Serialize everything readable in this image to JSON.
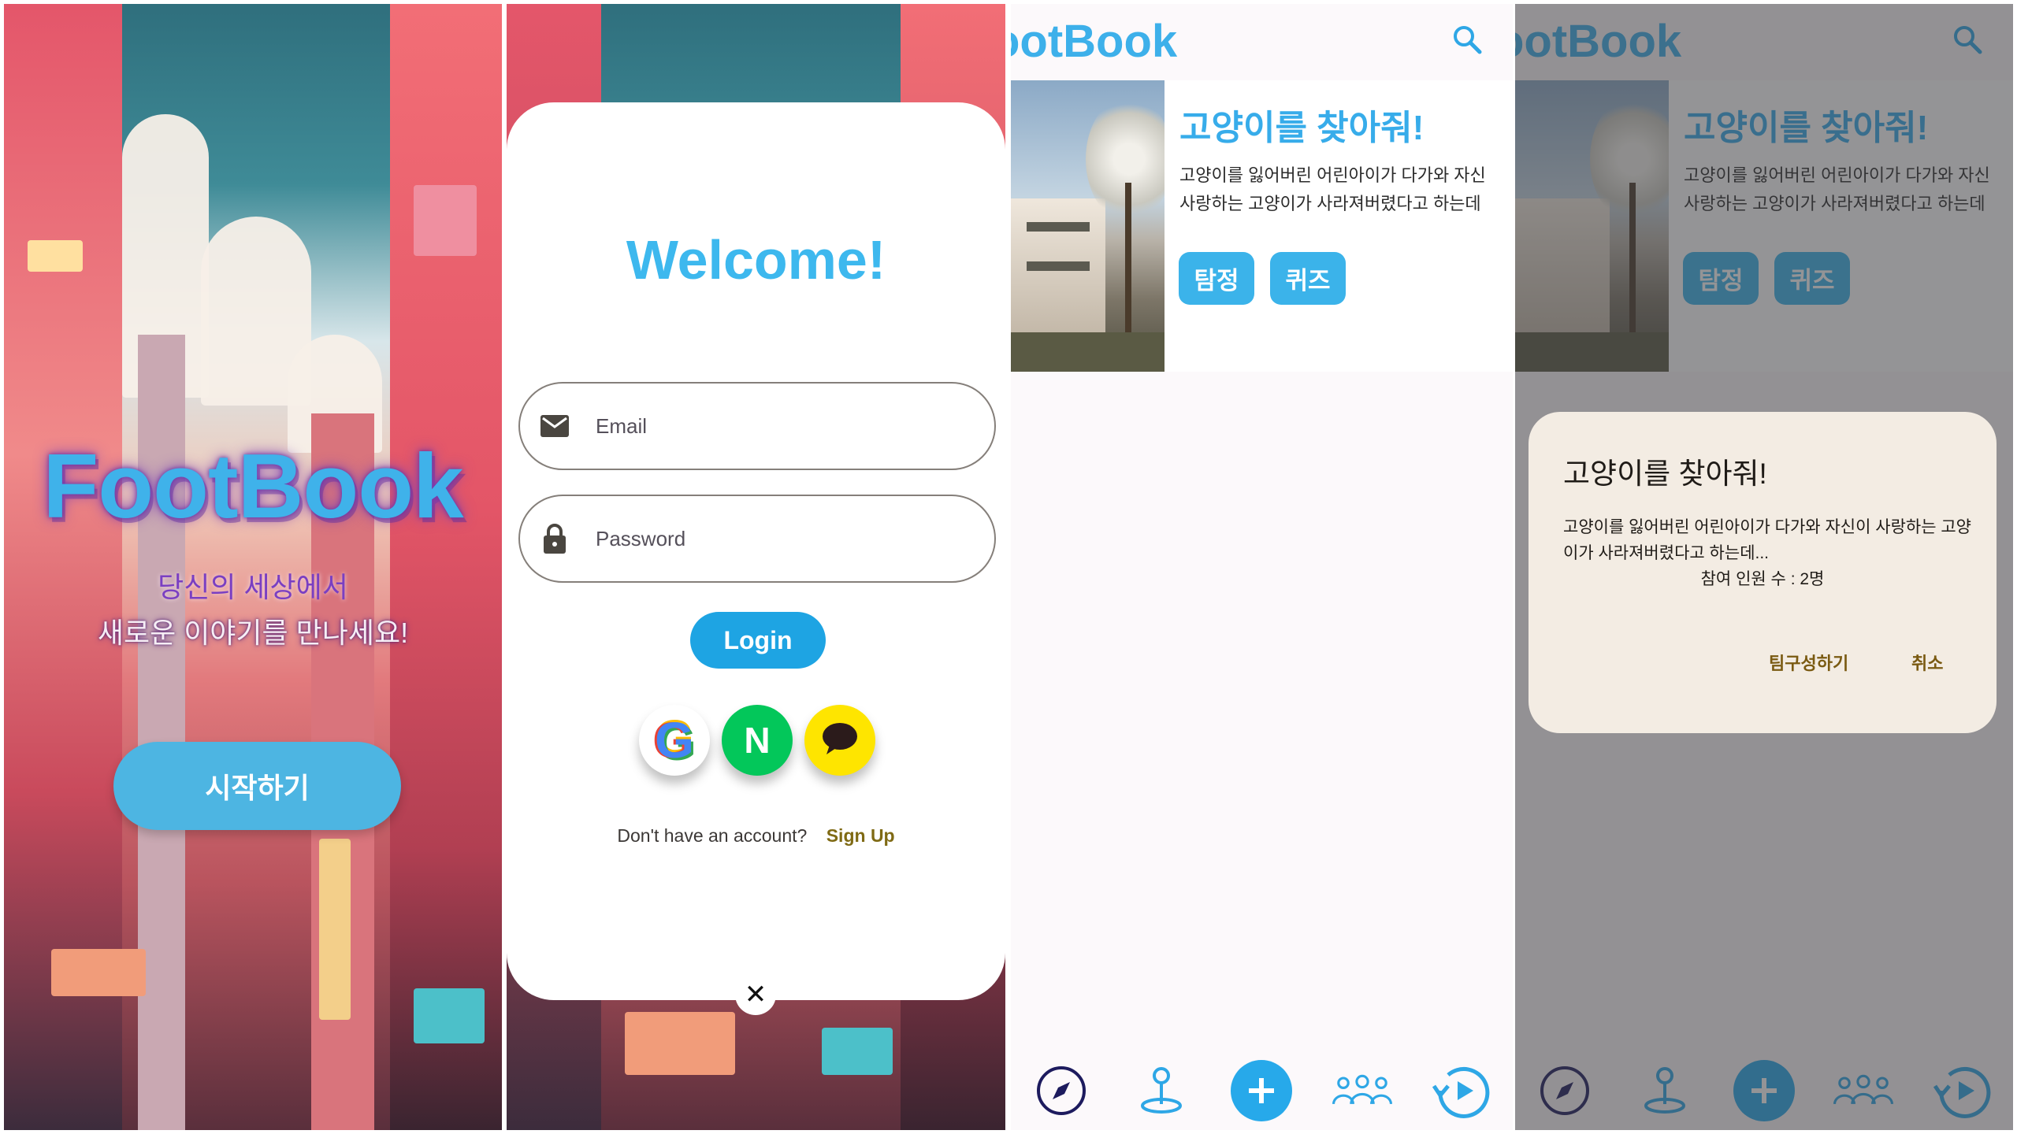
{
  "splash": {
    "brand": "FootBook",
    "tagline_line1": "당신의 세상에서",
    "tagline_line2": "새로운 이야기를 만나세요!",
    "start_button": "시작하기"
  },
  "login": {
    "welcome": "Welcome!",
    "email_placeholder": "Email",
    "password_placeholder": "Password",
    "login_button": "Login",
    "social": {
      "google": "G",
      "naver": "N"
    },
    "no_account_text": "Don't have an account?",
    "signup_link": "Sign Up",
    "close_glyph": "✕"
  },
  "feed": {
    "app_title": "ootBook",
    "post": {
      "title": "고양이를 찾아줘!",
      "desc_line1": "고양이를 잃어버린 어린아이가 다가와 자신",
      "desc_line2": "사랑하는 고양이가 사라져버렸다고 하는데",
      "chip_detective": "탐정",
      "chip_quiz": "퀴즈"
    },
    "nav": [
      "compass-icon",
      "map-pin-icon",
      "add-icon",
      "group-icon",
      "history-icon"
    ]
  },
  "dialog": {
    "title": "고양이를 찾아줘!",
    "body": "고양이를 잃어버린 어린아이가 다가와 자신이 사랑하는 고양이가 사라져버렸다고 하는데...",
    "participants": "참여 인원 수 : 2명",
    "confirm_button": "팀구성하기",
    "cancel_button": "취소"
  },
  "colors": {
    "accent": "#3db0ea",
    "fab": "#27a9ea",
    "nav_icon": "#1d1b5e",
    "dialog_bg": "#f3ece3",
    "link": "#7f6a14"
  }
}
